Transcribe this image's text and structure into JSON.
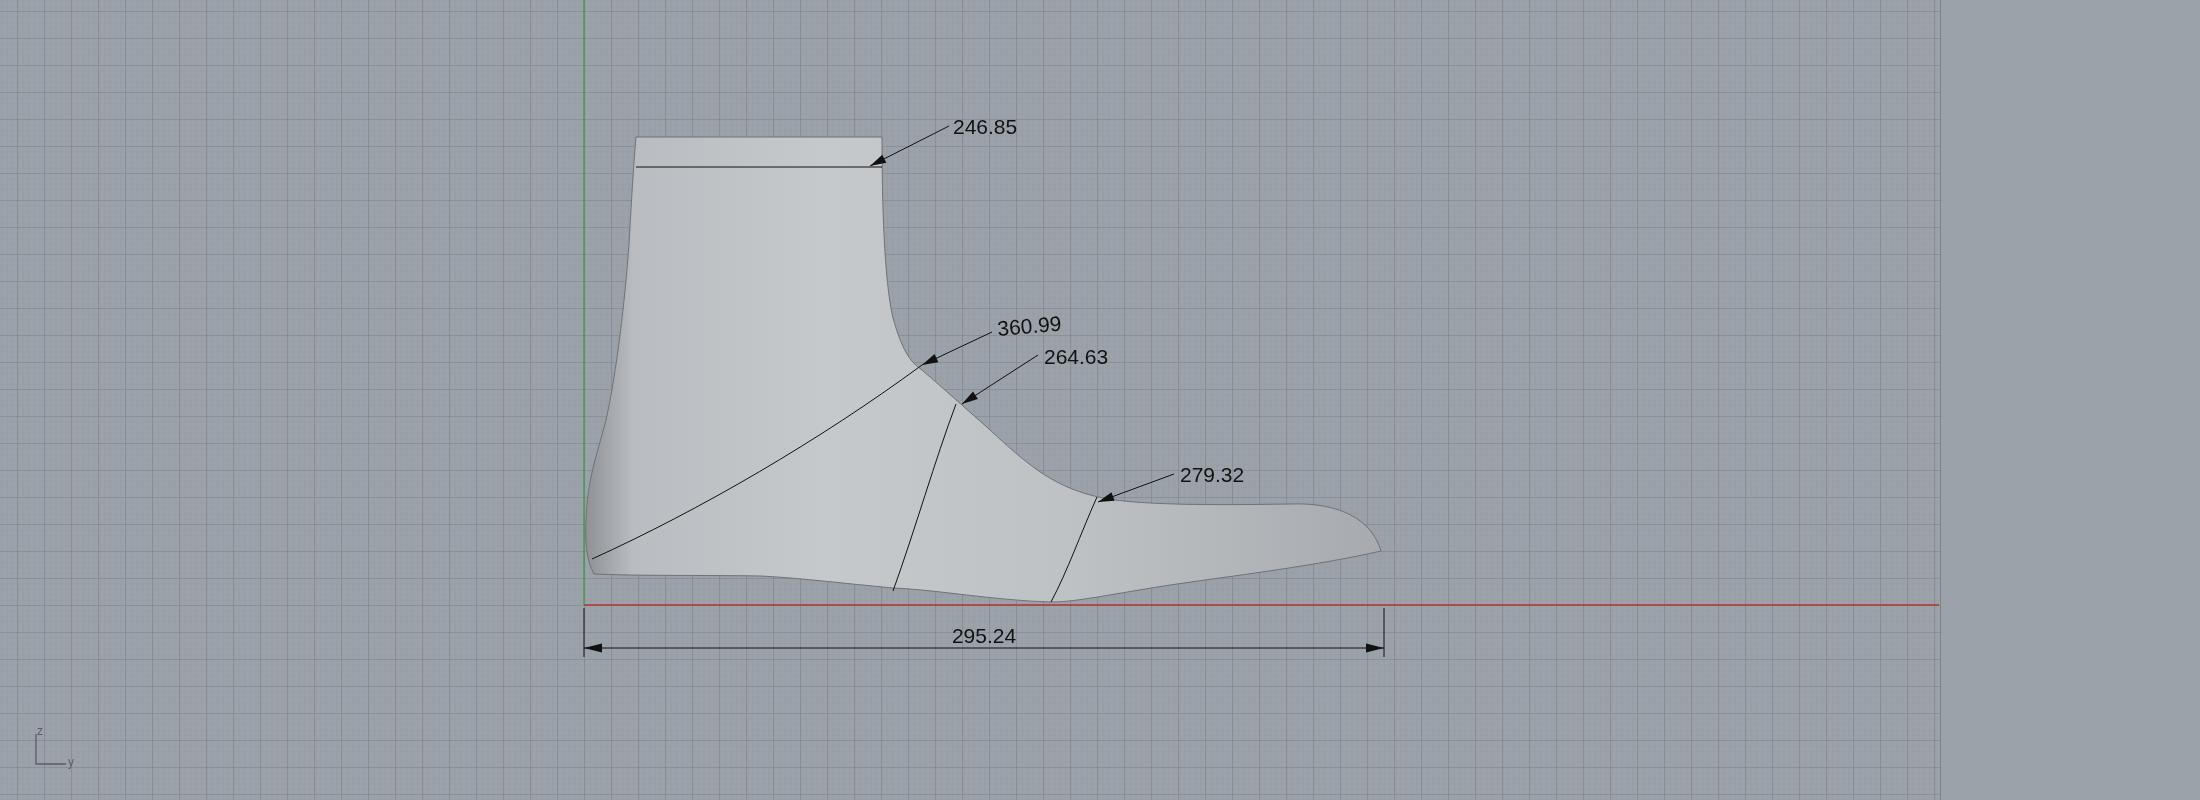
{
  "viewport": {
    "callouts": [
      "246.85",
      "360.99",
      "264.63",
      "279.32"
    ],
    "overall_length": "295.24",
    "axis_labels": [
      "z",
      "y"
    ]
  }
}
